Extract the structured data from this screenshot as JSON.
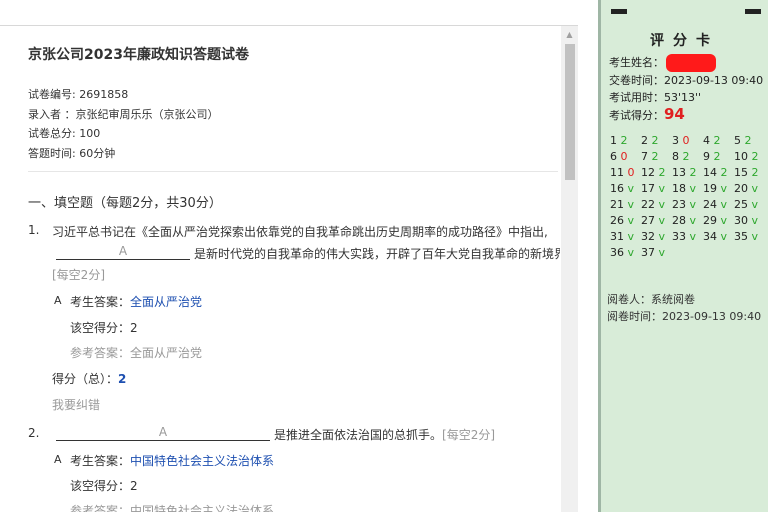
{
  "paper": {
    "title": "京张公司2023年廉政知识答题试卷",
    "info": [
      "试卷编号: 2691858",
      "录入者  ：京张纪审周乐乐（京张公司）",
      "试卷总分: 100",
      "答题时间: 60分钟"
    ],
    "section_title": "一、填空题（每题2分，共30分）"
  },
  "questions": [
    {
      "num": "1.",
      "text_line1": "习近平总书记在《全面从严治党探索出依靠党的自我革命跳出历史周期率的成功路径》中指出,",
      "blank_label": "A",
      "text_after_blank": "是新时代党的自我革命的伟大实践，开辟了百年大党自我革命的新境界。",
      "points_note": "[每空2分]",
      "answer_marker": "A",
      "answer_label": "考生答案：",
      "answer_value": "全面从严治党",
      "blank_score": "该空得分：2",
      "reference": "参考答案：全面从严治党",
      "total_label": "得分（总）：",
      "total_value": "2",
      "report_error": "我要纠错"
    },
    {
      "num": "2.",
      "blank_label": "A",
      "text_after_blank": "是推进全面依法治国的总抓手。",
      "points_note": "[每空2分]",
      "answer_marker": "A",
      "answer_label": "考生答案：",
      "answer_value": "中国特色社会主义法治体系",
      "blank_score": "该空得分：2",
      "reference": "参考答案：中国特色社会主义法治体系"
    }
  ],
  "score_card": {
    "title": "评分卡",
    "name_label": "考生姓名：",
    "submit_time": "交卷时间：2023-09-13 09:40",
    "time_used": "考试用时：53'13''",
    "score_label": "考试得分：",
    "score_value": "94",
    "grid": [
      {
        "n": "1",
        "m": "2"
      },
      {
        "n": "2",
        "m": "2"
      },
      {
        "n": "3",
        "m": "0"
      },
      {
        "n": "4",
        "m": "2"
      },
      {
        "n": "5",
        "m": "2"
      },
      {
        "n": "6",
        "m": "0"
      },
      {
        "n": "7",
        "m": "2"
      },
      {
        "n": "8",
        "m": "2"
      },
      {
        "n": "9",
        "m": "2"
      },
      {
        "n": "10",
        "m": "2"
      },
      {
        "n": "11",
        "m": "0"
      },
      {
        "n": "12",
        "m": "2"
      },
      {
        "n": "13",
        "m": "2"
      },
      {
        "n": "14",
        "m": "2"
      },
      {
        "n": "15",
        "m": "2"
      },
      {
        "n": "16",
        "m": "v"
      },
      {
        "n": "17",
        "m": "v"
      },
      {
        "n": "18",
        "m": "v"
      },
      {
        "n": "19",
        "m": "v"
      },
      {
        "n": "20",
        "m": "v"
      },
      {
        "n": "21",
        "m": "v"
      },
      {
        "n": "22",
        "m": "v"
      },
      {
        "n": "23",
        "m": "v"
      },
      {
        "n": "24",
        "m": "v"
      },
      {
        "n": "25",
        "m": "v"
      },
      {
        "n": "26",
        "m": "v"
      },
      {
        "n": "27",
        "m": "v"
      },
      {
        "n": "28",
        "m": "v"
      },
      {
        "n": "29",
        "m": "v"
      },
      {
        "n": "30",
        "m": "v"
      },
      {
        "n": "31",
        "m": "v"
      },
      {
        "n": "32",
        "m": "v"
      },
      {
        "n": "33",
        "m": "v"
      },
      {
        "n": "34",
        "m": "v"
      },
      {
        "n": "35",
        "m": "v"
      },
      {
        "n": "36",
        "m": "v"
      },
      {
        "n": "37",
        "m": "v"
      }
    ],
    "grader": "阅卷人：系统阅卷",
    "grade_time": "阅卷时间：2023-09-13 09:40"
  },
  "icons": {
    "scroll_up": "scroll-up-arrow-icon",
    "card_marks": "black-bar-mark-icon"
  },
  "colors": {
    "answer_blue": "#1d4fb0",
    "score_red": "#e02020",
    "ok_green": "#2ea82e",
    "card_bg": "#d8ecd8",
    "redaction_red": "#ff1a1a"
  }
}
